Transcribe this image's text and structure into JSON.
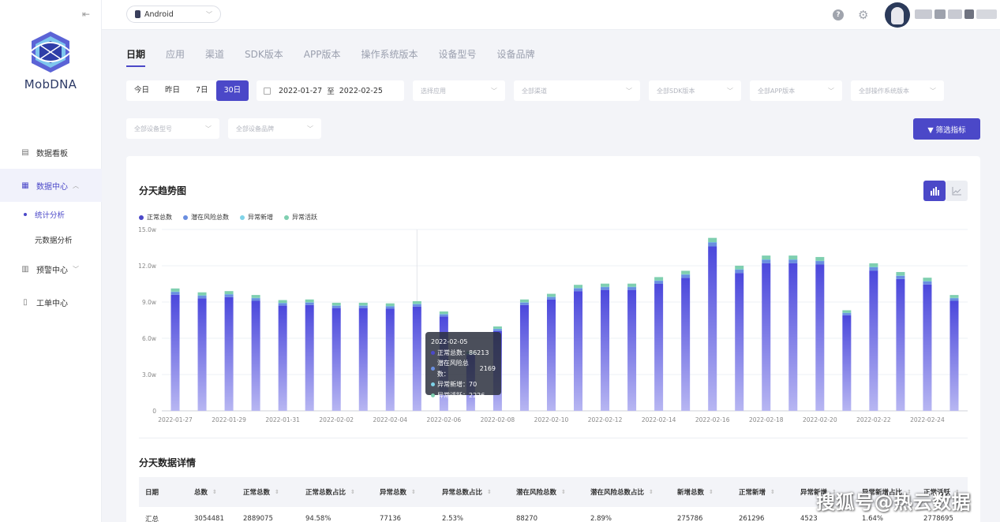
{
  "sidebar": {
    "logo_text": "MobDNA",
    "items": [
      {
        "label": "数据看板"
      },
      {
        "label": "数据中心"
      },
      {
        "label": "预警中心"
      },
      {
        "label": "工单中心"
      }
    ],
    "sub_items": [
      {
        "label": "统计分析"
      },
      {
        "label": "元数据分析"
      }
    ]
  },
  "topbar": {
    "platform": "Android"
  },
  "tabs": [
    {
      "label": "日期"
    },
    {
      "label": "应用"
    },
    {
      "label": "渠道"
    },
    {
      "label": "SDK版本"
    },
    {
      "label": "APP版本"
    },
    {
      "label": "操作系统版本"
    },
    {
      "label": "设备型号"
    },
    {
      "label": "设备品牌"
    }
  ],
  "filters": {
    "ranges": [
      "今日",
      "昨日",
      "7日",
      "30日"
    ],
    "date_start": "2022-01-27",
    "date_sep": "至",
    "date_end": "2022-02-25",
    "dropdowns": [
      "选择应用",
      "全部渠道",
      "全部SDK版本",
      "全部APP版本",
      "全部操作系统版本",
      "全部设备型号",
      "全部设备品牌"
    ],
    "filter_button": "▼ 筛选指标"
  },
  "chart_section": {
    "title": "分天趋势图",
    "legend": [
      {
        "label": "正常总数",
        "color": "#4b48c8"
      },
      {
        "label": "潜在风险总数",
        "color": "#6a8ee0"
      },
      {
        "label": "异常新增",
        "color": "#7fd3e8"
      },
      {
        "label": "异常活跃",
        "color": "#7fcfb0"
      }
    ],
    "tooltip": {
      "date": "2022-02-05",
      "rows": [
        {
          "label": "正常总数：",
          "value": "86213",
          "color": "#4b48c8"
        },
        {
          "label": "潜在风险总数：",
          "value": "2169",
          "color": "#6a8ee0"
        },
        {
          "label": "异常新增：",
          "value": "70",
          "color": "#7fd3e8"
        },
        {
          "label": "异常活跃：",
          "value": "2226",
          "color": "#7fcfb0"
        }
      ]
    }
  },
  "chart_data": {
    "type": "bar",
    "stacked": true,
    "categories": [
      "2022-01-27",
      "2022-01-28",
      "2022-01-29",
      "2022-01-30",
      "2022-01-31",
      "2022-02-01",
      "2022-02-02",
      "2022-02-03",
      "2022-02-04",
      "2022-02-05",
      "2022-02-06",
      "2022-02-07",
      "2022-02-08",
      "2022-02-09",
      "2022-02-10",
      "2022-02-11",
      "2022-02-12",
      "2022-02-13",
      "2022-02-14",
      "2022-02-15",
      "2022-02-16",
      "2022-02-17",
      "2022-02-18",
      "2022-02-19",
      "2022-02-20",
      "2022-02-21",
      "2022-02-22",
      "2022-02-23",
      "2022-02-24",
      "2022-02-25"
    ],
    "x_tick_labels": [
      "2022-01-27",
      "2022-01-29",
      "2022-01-31",
      "2022-02-02",
      "2022-02-04",
      "2022-02-06",
      "2022-02-08",
      "2022-02-10",
      "2022-02-12",
      "2022-02-14",
      "2022-02-16",
      "2022-02-18",
      "2022-02-20",
      "2022-02-22",
      "2022-02-24"
    ],
    "y_tick_labels": [
      "0",
      "3.0w",
      "6.0w",
      "9.0w",
      "12.0w",
      "15.0w"
    ],
    "ylim": [
      0,
      150000
    ],
    "series": [
      {
        "name": "正常总数",
        "values": [
          96000,
          93000,
          94000,
          91000,
          87000,
          87500,
          85000,
          85000,
          84500,
          86213,
          78000,
          46000,
          66000,
          87500,
          92000,
          99000,
          100000,
          100000,
          105000,
          110000,
          136000,
          114000,
          122000,
          122000,
          121000,
          79000,
          116000,
          109000,
          104500,
          91000
        ]
      },
      {
        "name": "潜在风险总数",
        "values": [
          2500,
          2400,
          2400,
          2300,
          2200,
          2200,
          2100,
          2100,
          2100,
          2169,
          2000,
          1500,
          1800,
          2200,
          2300,
          2500,
          2500,
          2500,
          2700,
          2800,
          3400,
          2900,
          3100,
          3100,
          3000,
          2000,
          2900,
          2800,
          2700,
          2300
        ]
      },
      {
        "name": "异常新增",
        "values": [
          100,
          100,
          100,
          100,
          90,
          90,
          80,
          80,
          80,
          70,
          70,
          60,
          70,
          90,
          90,
          100,
          100,
          100,
          110,
          110,
          140,
          120,
          120,
          120,
          120,
          80,
          120,
          110,
          110,
          90
        ]
      },
      {
        "name": "异常活跃",
        "values": [
          2600,
          2500,
          2500,
          2400,
          2300,
          2300,
          2200,
          2200,
          2200,
          2226,
          2100,
          1500,
          1900,
          2300,
          2400,
          2600,
          2600,
          2600,
          2800,
          2900,
          3500,
          3000,
          3200,
          3200,
          3100,
          2100,
          3000,
          2900,
          2800,
          2400
        ]
      }
    ]
  },
  "detail_section": {
    "title": "分天数据详情",
    "columns": [
      "日期",
      "总数",
      "正常总数",
      "正常总数占比",
      "异常总数",
      "异常总数占比",
      "潜在风险总数",
      "潜在风险总数占比",
      "新增总数",
      "正常新增",
      "异常新增",
      "异常新增占比",
      "正常活跃"
    ],
    "rows": [
      [
        "汇总",
        "3054481",
        "2889075",
        "94.58%",
        "77136",
        "2.53%",
        "88270",
        "2.89%",
        "275786",
        "261296",
        "4523",
        "1.64%",
        "2778695"
      ]
    ]
  },
  "watermark": "搜狐号@热云数据"
}
